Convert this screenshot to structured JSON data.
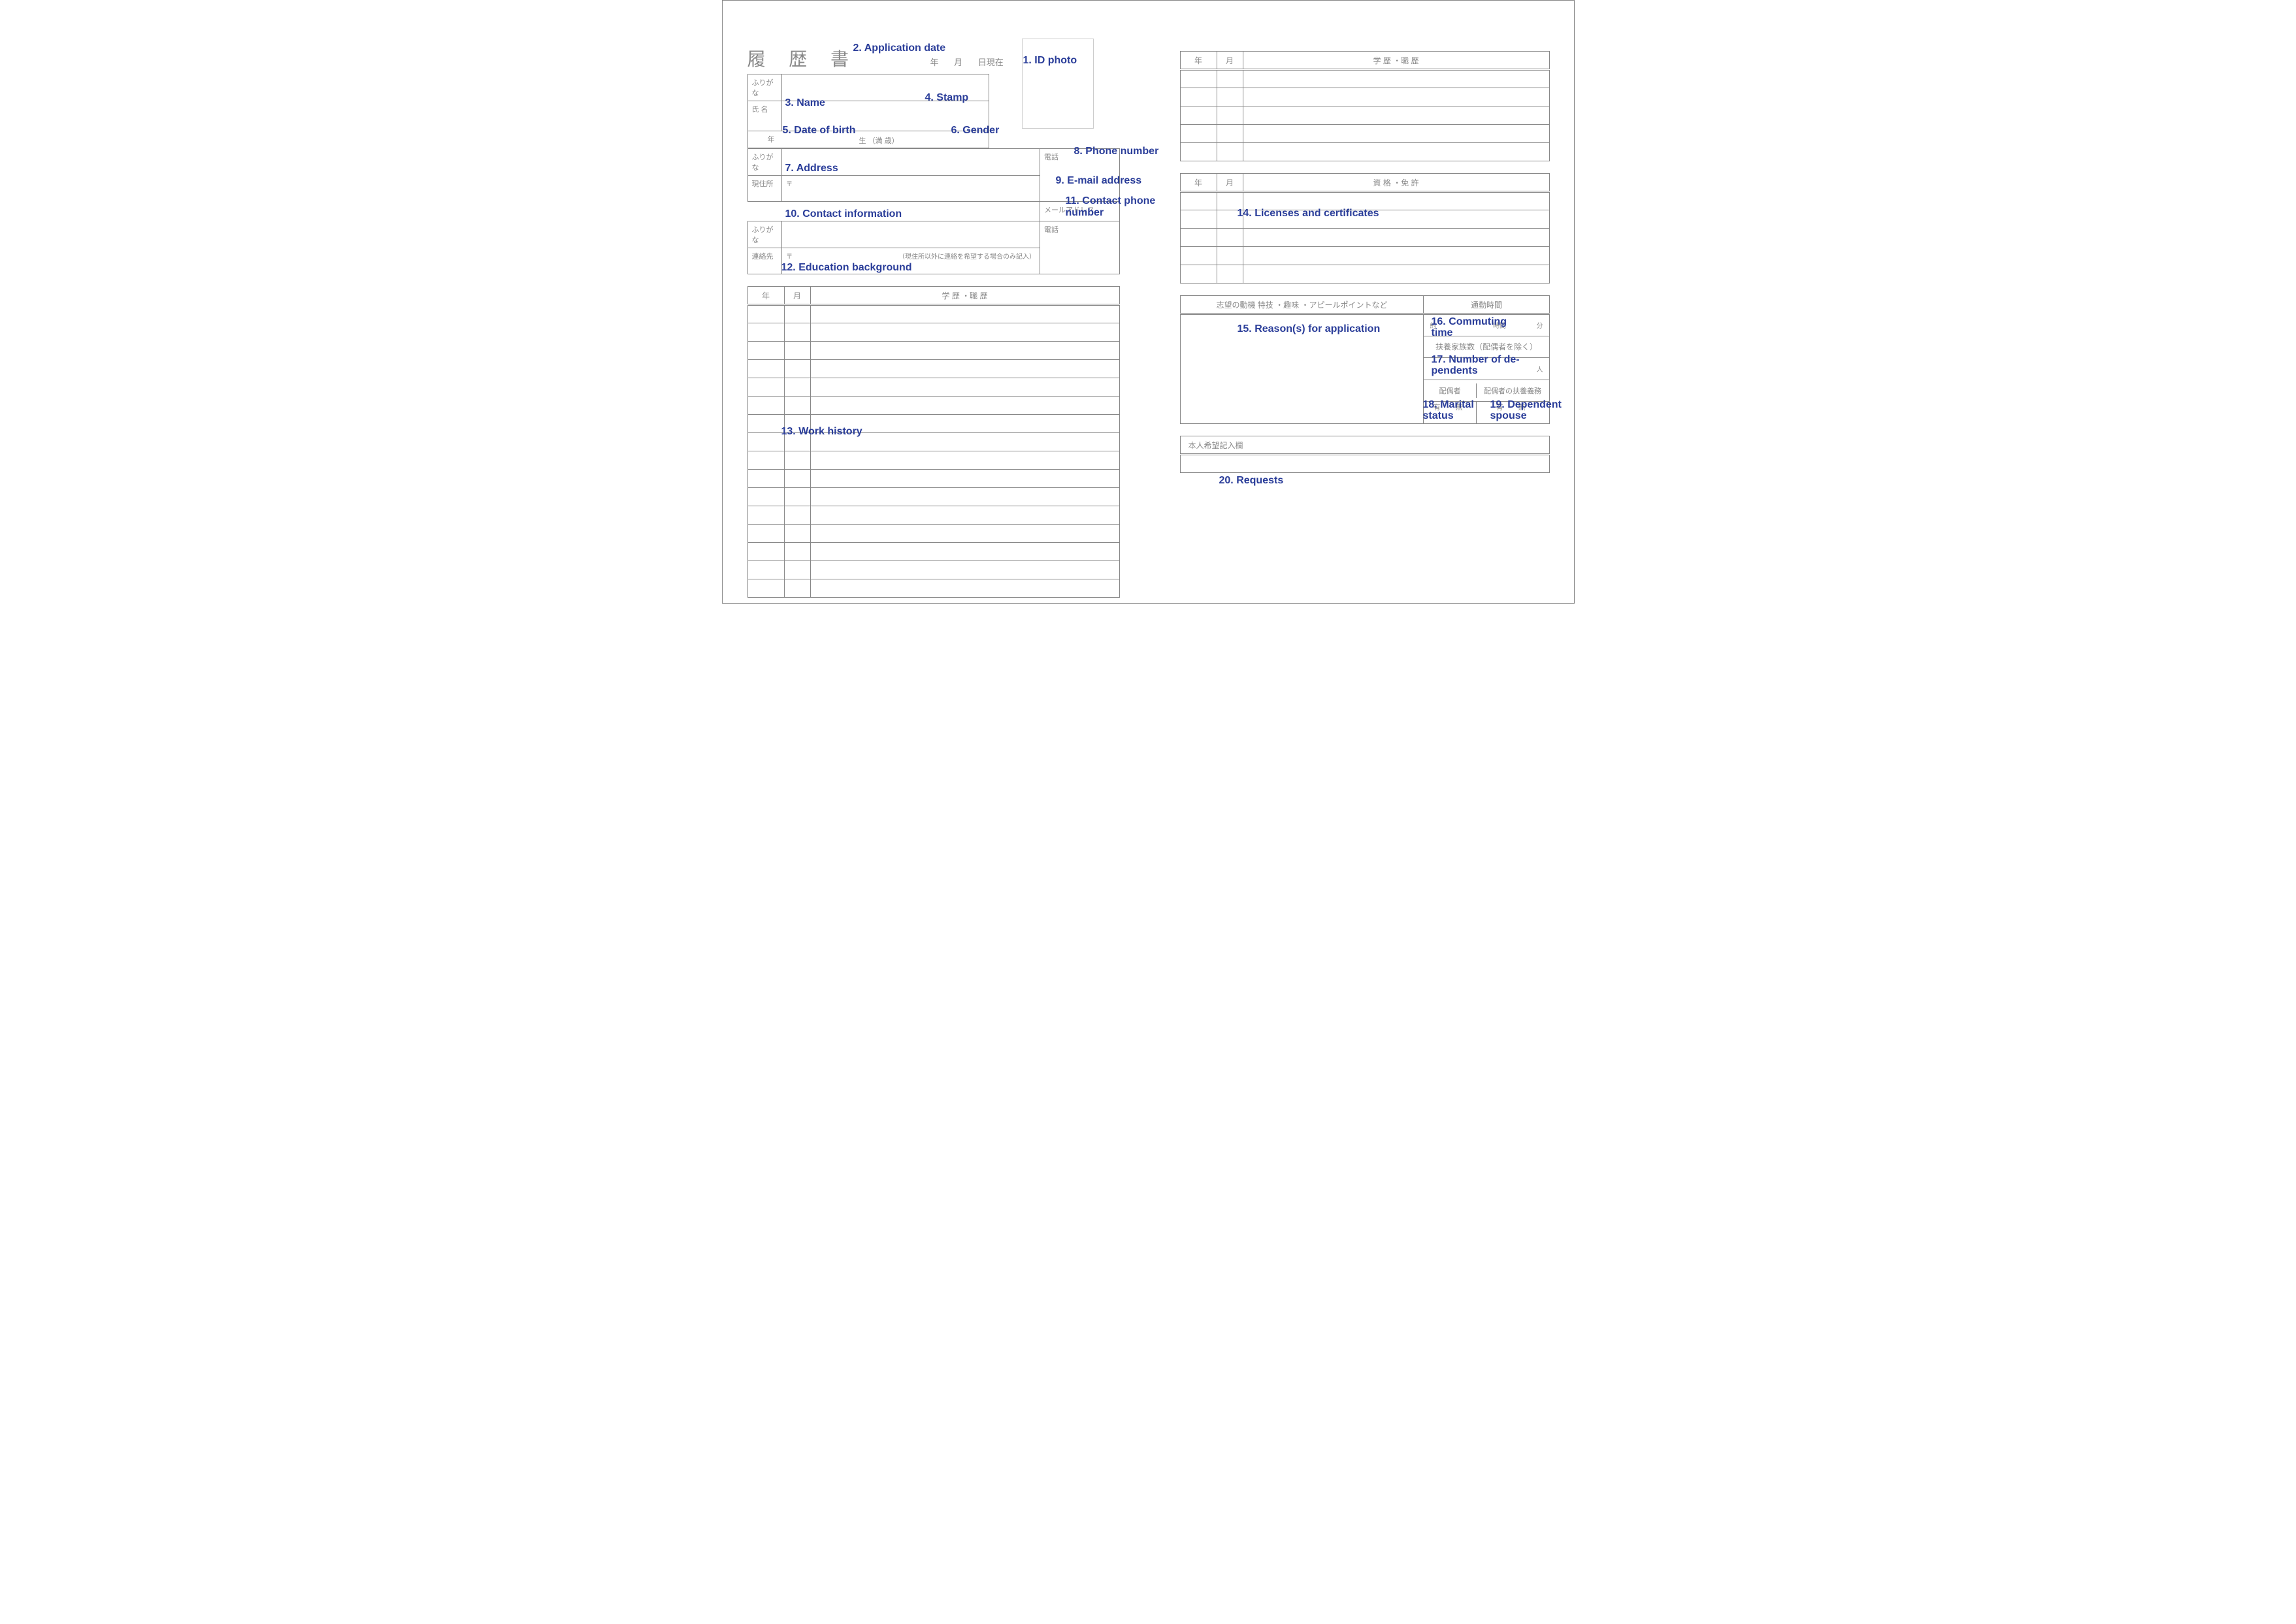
{
  "doc_title": "履 歴 書",
  "date_units": {
    "y": "年",
    "m": "月",
    "d": "日現在"
  },
  "photo_label": "",
  "labels": {
    "furigana": "ふりがな",
    "name": "氏 名",
    "dob_year": "年",
    "dob_suffix": "生   （満       歳）",
    "address": "現住所",
    "postal": "〒",
    "tel": "電話",
    "email": "メールアドレス",
    "contact": "連絡先",
    "contact_note": "（現住所以外に連絡を希望する場合のみ記入）"
  },
  "history_head": {
    "y": "年",
    "m": "月",
    "title": "学 歴 ・職 歴"
  },
  "qual_head": {
    "y": "年",
    "m": "月",
    "title": "資 格 ・免 許"
  },
  "motive_head": "志望の動機  特技 ・趣味 ・アピールポイントなど",
  "commute_head": "通勤時間",
  "commute_units": {
    "approx": "約",
    "h": "時間",
    "m": "分"
  },
  "dependents_head": "扶養家族数（配偶者を除く）",
  "dependents_unit": "人",
  "spouse_head": "配偶者",
  "spouse_support_head": "配偶者の扶養義務",
  "yn": "有・無",
  "req_head": "本人希望記入欄",
  "annotations": {
    "a1": "1. ID photo",
    "a2": "2. Application date",
    "a3": "3. Name",
    "a4": "4. Stamp",
    "a5": "5. Date of birth",
    "a6": "6. Gender",
    "a7": "7. Address",
    "a8": "8. Phone number",
    "a9": "9. E-mail address",
    "a10": "10. Contact information",
    "a11": "11. Contact phone\nnumber",
    "a12": "12. Education background",
    "a13": "13. Work history",
    "a14": "14. Licenses and certificates",
    "a15": "15. Reason(s) for application",
    "a16": "16. Commuting\ntime",
    "a17": "17. Number of de-\npendents",
    "a18": "18. Marital\nstatus",
    "a19": "19. Dependent\nspouse",
    "a20": "20. Requests"
  }
}
